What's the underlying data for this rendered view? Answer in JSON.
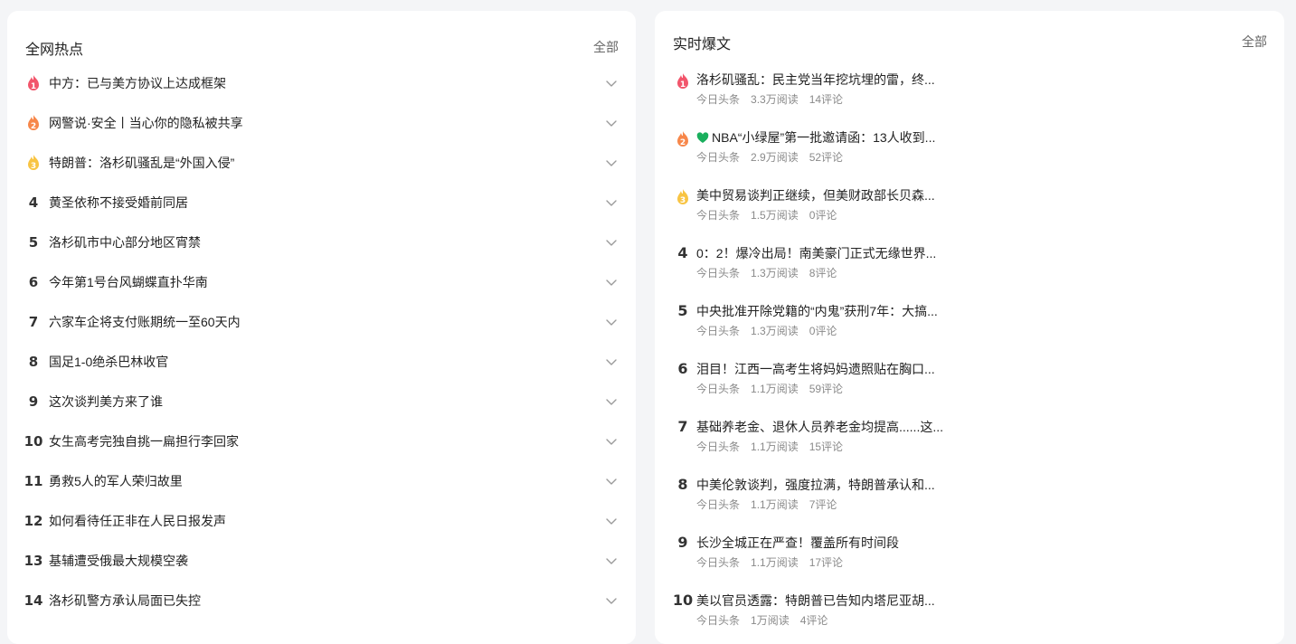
{
  "left_panel": {
    "title": "全网热点",
    "all_label": "全部",
    "items": [
      {
        "rank": "1",
        "title": "中方：已与美方协议上达成框架",
        "badge_color": "#f2556b"
      },
      {
        "rank": "2",
        "title": "网警说·安全丨当心你的隐私被共享",
        "badge_color": "#f7874a"
      },
      {
        "rank": "3",
        "title": "特朗普：洛杉矶骚乱是“外国入侵”",
        "badge_color": "#f8c443"
      },
      {
        "rank": "4",
        "title": "黄圣依称不接受婚前同居"
      },
      {
        "rank": "5",
        "title": "洛杉矶市中心部分地区宵禁"
      },
      {
        "rank": "6",
        "title": "今年第1号台风蝴蝶直扑华南"
      },
      {
        "rank": "7",
        "title": "六家车企将支付账期统一至60天内"
      },
      {
        "rank": "8",
        "title": "国足1-0绝杀巴林收官"
      },
      {
        "rank": "9",
        "title": "这次谈判美方来了谁"
      },
      {
        "rank": "10",
        "title": "女生高考完独自挑一扁担行李回家"
      },
      {
        "rank": "11",
        "title": "勇救5人的军人荣归故里"
      },
      {
        "rank": "12",
        "title": "如何看待任正非在人民日报发声"
      },
      {
        "rank": "13",
        "title": "基辅遭受俄最大规模空袭"
      },
      {
        "rank": "14",
        "title": "洛杉矶警方承认局面已失控"
      }
    ]
  },
  "right_panel": {
    "title": "实时爆文",
    "all_label": "全部",
    "items": [
      {
        "rank": "1",
        "title": "洛杉矶骚乱：民主党当年挖坑埋的雷，终...",
        "source": "今日头条",
        "reads": "3.3万阅读",
        "comments": "14评论",
        "badge_color": "#f2556b"
      },
      {
        "rank": "2",
        "title": "NBA“小绿屋”第一批邀请函：13人收到...",
        "source": "今日头条",
        "reads": "2.9万阅读",
        "comments": "52评论",
        "badge_color": "#f7874a",
        "heart_color": "#1aaf5d"
      },
      {
        "rank": "3",
        "title": "美中贸易谈判正继续，但美财政部长贝森...",
        "source": "今日头条",
        "reads": "1.5万阅读",
        "comments": "0评论",
        "badge_color": "#f8c443"
      },
      {
        "rank": "4",
        "title": "0：2！爆冷出局！南美豪门正式无缘世界...",
        "source": "今日头条",
        "reads": "1.3万阅读",
        "comments": "8评论"
      },
      {
        "rank": "5",
        "title": "中央批准开除党籍的“内鬼”获刑7年：大搞...",
        "source": "今日头条",
        "reads": "1.3万阅读",
        "comments": "0评论"
      },
      {
        "rank": "6",
        "title": "泪目！江西一高考生将妈妈遗照贴在胸口...",
        "source": "今日头条",
        "reads": "1.1万阅读",
        "comments": "59评论"
      },
      {
        "rank": "7",
        "title": "基础养老金、退休人员养老金均提高......这...",
        "source": "今日头条",
        "reads": "1.1万阅读",
        "comments": "15评论"
      },
      {
        "rank": "8",
        "title": "中美伦敦谈判，强度拉满，特朗普承认和...",
        "source": "今日头条",
        "reads": "1.1万阅读",
        "comments": "7评论"
      },
      {
        "rank": "9",
        "title": "长沙全城正在严查！覆盖所有时间段",
        "source": "今日头条",
        "reads": "1.1万阅读",
        "comments": "17评论"
      },
      {
        "rank": "10",
        "title": "美以官员透露：特朗普已告知内塔尼亚胡...",
        "source": "今日头条",
        "reads": "1万阅读",
        "comments": "4评论"
      }
    ]
  }
}
